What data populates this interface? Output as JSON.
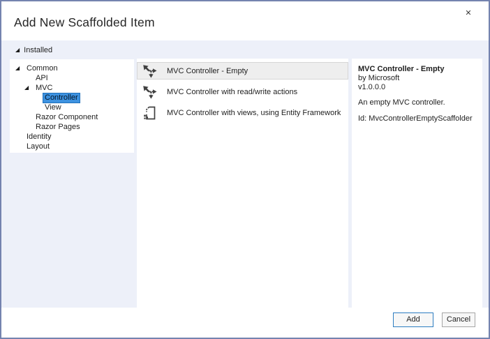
{
  "window": {
    "title": "Add New Scaffolded Item",
    "close_glyph": "✕"
  },
  "icons": {
    "expander": "◢"
  },
  "header": {
    "installed_label": "Installed"
  },
  "tree": {
    "items": [
      {
        "label": "Common",
        "level": 0,
        "expander": true,
        "selected": false
      },
      {
        "label": "API",
        "level": 1,
        "expander": false,
        "selected": false
      },
      {
        "label": "MVC",
        "level": 1,
        "expander": true,
        "selected": false
      },
      {
        "label": "Controller",
        "level": 2,
        "expander": false,
        "selected": true
      },
      {
        "label": "View",
        "level": 2,
        "expander": false,
        "selected": false
      },
      {
        "label": "Razor Component",
        "level": 1,
        "expander": false,
        "selected": false
      },
      {
        "label": "Razor Pages",
        "level": 1,
        "expander": false,
        "selected": false
      },
      {
        "label": "Identity",
        "level": 0,
        "expander": false,
        "selected": false
      },
      {
        "label": "Layout",
        "level": 0,
        "expander": false,
        "selected": false
      }
    ]
  },
  "list": {
    "items": [
      {
        "label": "MVC Controller - Empty",
        "icon": "mvc-controller-icon",
        "selected": true
      },
      {
        "label": "MVC Controller with read/write actions",
        "icon": "mvc-controller-icon",
        "selected": false
      },
      {
        "label": "MVC Controller with views, using Entity Framework",
        "icon": "ef-view-icon",
        "selected": false
      }
    ]
  },
  "details": {
    "title": "MVC Controller - Empty",
    "author": "by Microsoft",
    "version": "v1.0.0.0",
    "description": "An empty MVC controller.",
    "id": "Id: MvcControllerEmptyScaffolder"
  },
  "footer": {
    "add_label": "Add",
    "cancel_label": "Cancel"
  },
  "colors": {
    "dialog_border": "#7483af",
    "content_background": "#edf0f9",
    "tree_selection": "#3d92e0",
    "tree_selection_border": "#1f70bb",
    "list_selection": "#eeeeee",
    "list_selection_border": "#d6d6d6",
    "default_button_border": "#2d7dc1",
    "icon_color": "#414141"
  }
}
